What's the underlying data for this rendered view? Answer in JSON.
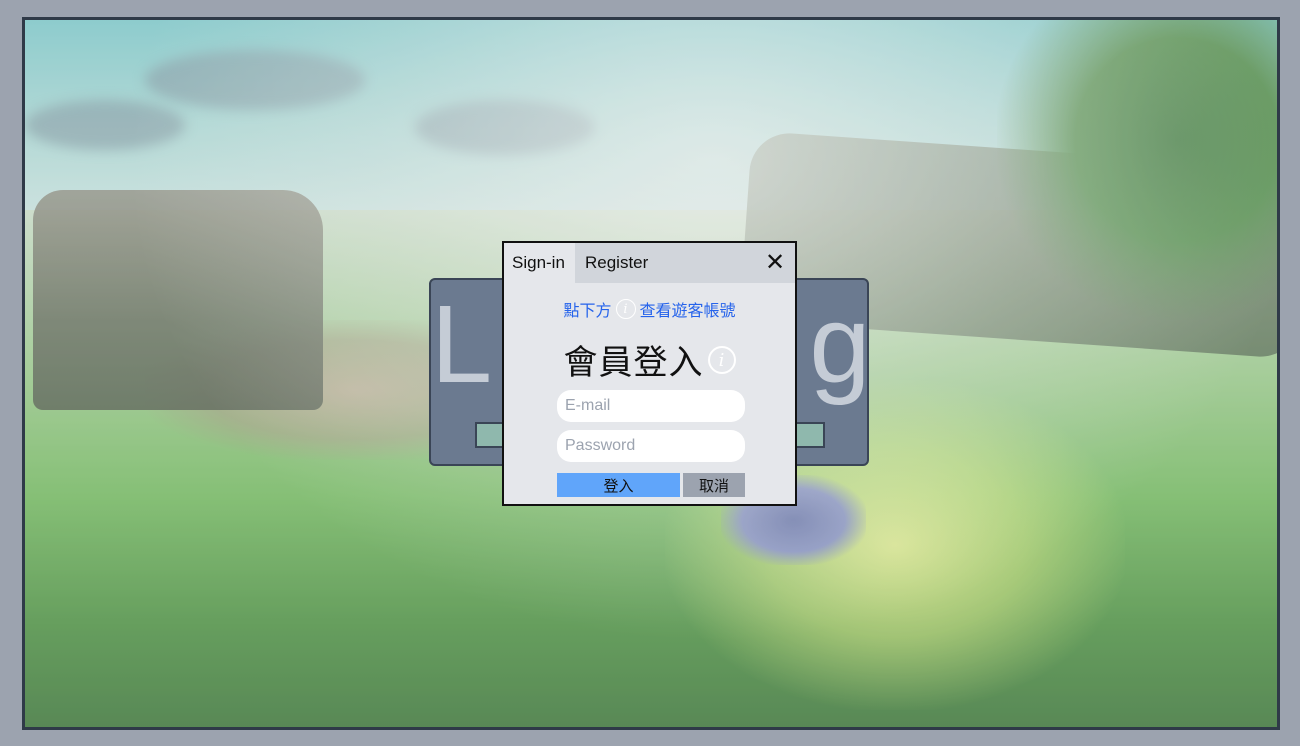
{
  "background": {
    "loading_text": "Loading"
  },
  "dialog": {
    "tabs": [
      {
        "label": "Sign-in"
      },
      {
        "label": "Register"
      }
    ],
    "close_label": "✕",
    "hint": {
      "prefix": "點下方",
      "info_icon": "i",
      "suffix": "查看遊客帳號"
    },
    "title": "會員登入",
    "title_info_icon": "i",
    "email": {
      "placeholder": "E-mail",
      "value": ""
    },
    "password": {
      "placeholder": "Password",
      "value": ""
    },
    "login_label": "登入",
    "cancel_label": "取消"
  },
  "colors": {
    "accent": "#60a5fa",
    "link": "#2563eb",
    "dialog_bg": "#e5e7eb",
    "page_bg": "#9ca3af"
  }
}
